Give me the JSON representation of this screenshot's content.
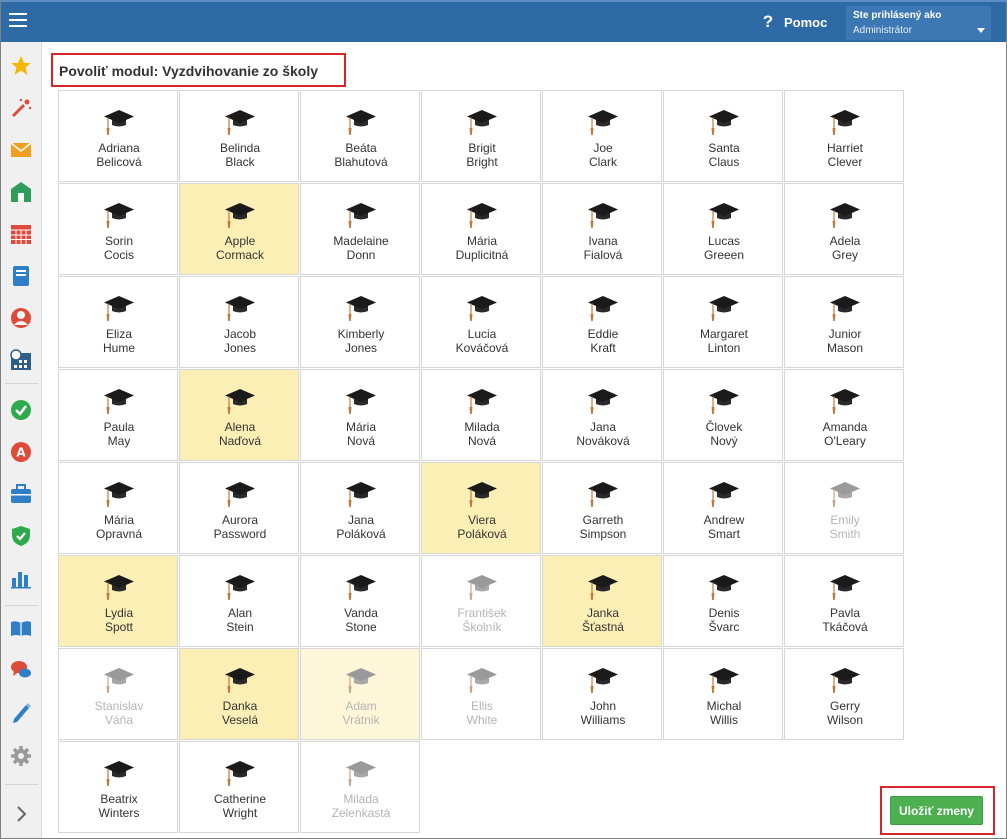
{
  "header": {
    "help_icon": "question-icon",
    "help_glyph": "?",
    "help_label": "Pomoc",
    "user_line1": "Ste prihlásený ako",
    "user_line2": "Administrátor"
  },
  "colors": {
    "header_bg": "#2e6aa6",
    "selected_card": "#fcefb5",
    "save_button": "#4caf50",
    "highlight_border": "#d9252a"
  },
  "sidebar": {
    "items": [
      {
        "icon": "star-icon",
        "color": "#f5b800"
      },
      {
        "icon": "magic-wand-icon",
        "color": "#e04a3a"
      },
      {
        "icon": "envelope-icon",
        "color": "#f0a020"
      },
      {
        "icon": "school-icon",
        "color": "#2e9e5a"
      },
      {
        "icon": "calendar-grid-icon",
        "color": "#e04a3a"
      },
      {
        "icon": "notebook-icon",
        "color": "#2e7ec8"
      },
      {
        "icon": "user-circle-icon",
        "color": "#e04a3a"
      },
      {
        "icon": "timetable-icon",
        "color": "#2e5f8a"
      },
      {
        "icon": "check-circle-icon",
        "color": "#2eaa4a"
      },
      {
        "icon": "grade-a-icon",
        "color": "#e04a3a"
      },
      {
        "icon": "briefcase-icon",
        "color": "#2e7ec8"
      },
      {
        "icon": "shield-check-icon",
        "color": "#2eaa4a"
      },
      {
        "icon": "bar-chart-icon",
        "color": "#2e7ec8"
      },
      {
        "icon": "open-book-icon",
        "color": "#2e7ec8"
      },
      {
        "icon": "chat-bubbles-icon",
        "color": "#e04a3a"
      },
      {
        "icon": "pencil-icon",
        "color": "#2e7ec8"
      },
      {
        "icon": "gear-icon",
        "color": "#9a9a9a"
      },
      {
        "icon": "chevron-right-icon",
        "color": "#666666"
      }
    ]
  },
  "page": {
    "title": "Povoliť modul: Vyzdvihovanie zo školy"
  },
  "students": [
    {
      "first": "Adriana",
      "last": "Belicová",
      "selected": false,
      "enabled": true
    },
    {
      "first": "Belinda",
      "last": "Black",
      "selected": false,
      "enabled": true
    },
    {
      "first": "Beáta",
      "last": "Blahutová",
      "selected": false,
      "enabled": true
    },
    {
      "first": "Brigit",
      "last": "Bright",
      "selected": false,
      "enabled": true
    },
    {
      "first": "Joe",
      "last": "Clark",
      "selected": false,
      "enabled": true
    },
    {
      "first": "Santa",
      "last": "Claus",
      "selected": false,
      "enabled": true
    },
    {
      "first": "Harriet",
      "last": "Clever",
      "selected": false,
      "enabled": true
    },
    {
      "first": "Sorin",
      "last": "Cocis",
      "selected": false,
      "enabled": true
    },
    {
      "first": "Apple",
      "last": "Cormack",
      "selected": true,
      "enabled": true
    },
    {
      "first": "Madelaine",
      "last": "Donn",
      "selected": false,
      "enabled": true
    },
    {
      "first": "Mária",
      "last": "Duplicitná",
      "selected": false,
      "enabled": true
    },
    {
      "first": "Ivana",
      "last": "Fialová",
      "selected": false,
      "enabled": true
    },
    {
      "first": "Lucas",
      "last": "Greeen",
      "selected": false,
      "enabled": true
    },
    {
      "first": "Adela",
      "last": "Grey",
      "selected": false,
      "enabled": true
    },
    {
      "first": "Eliza",
      "last": "Hume",
      "selected": false,
      "enabled": true
    },
    {
      "first": "Jacob",
      "last": "Jones",
      "selected": false,
      "enabled": true
    },
    {
      "first": "Kimberly",
      "last": "Jones",
      "selected": false,
      "enabled": true
    },
    {
      "first": "Lucia",
      "last": "Kováčová",
      "selected": false,
      "enabled": true
    },
    {
      "first": "Eddie",
      "last": "Kraft",
      "selected": false,
      "enabled": true
    },
    {
      "first": "Margaret",
      "last": "Linton",
      "selected": false,
      "enabled": true
    },
    {
      "first": "Junior",
      "last": "Mason",
      "selected": false,
      "enabled": true
    },
    {
      "first": "Paula",
      "last": "May",
      "selected": false,
      "enabled": true
    },
    {
      "first": "Alena",
      "last": "Naďová",
      "selected": true,
      "enabled": true
    },
    {
      "first": "Mária",
      "last": "Nová",
      "selected": false,
      "enabled": true
    },
    {
      "first": "Milada",
      "last": "Nová",
      "selected": false,
      "enabled": true
    },
    {
      "first": "Jana",
      "last": "Nováková",
      "selected": false,
      "enabled": true
    },
    {
      "first": "Človek",
      "last": "Nový",
      "selected": false,
      "enabled": true
    },
    {
      "first": "Amanda",
      "last": "O'Leary",
      "selected": false,
      "enabled": true
    },
    {
      "first": "Mária",
      "last": "Opravná",
      "selected": false,
      "enabled": true
    },
    {
      "first": "Aurora",
      "last": "Password",
      "selected": false,
      "enabled": true
    },
    {
      "first": "Jana",
      "last": "Poláková",
      "selected": false,
      "enabled": true
    },
    {
      "first": "Viera",
      "last": "Poláková",
      "selected": true,
      "enabled": true
    },
    {
      "first": "Garreth",
      "last": "Simpson",
      "selected": false,
      "enabled": true
    },
    {
      "first": "Andrew",
      "last": "Smart",
      "selected": false,
      "enabled": true
    },
    {
      "first": "Emily",
      "last": "Smith",
      "selected": false,
      "enabled": false
    },
    {
      "first": "Lydia",
      "last": "Spott",
      "selected": true,
      "enabled": true
    },
    {
      "first": "Alan",
      "last": "Stein",
      "selected": false,
      "enabled": true
    },
    {
      "first": "Vanda",
      "last": "Stone",
      "selected": false,
      "enabled": true
    },
    {
      "first": "František",
      "last": "Školník",
      "selected": false,
      "enabled": false
    },
    {
      "first": "Janka",
      "last": "Šťastná",
      "selected": true,
      "enabled": true
    },
    {
      "first": "Denis",
      "last": "Švarc",
      "selected": false,
      "enabled": true
    },
    {
      "first": "Pavla",
      "last": "Tkáčová",
      "selected": false,
      "enabled": true
    },
    {
      "first": "Stanislav",
      "last": "Váňa",
      "selected": false,
      "enabled": false
    },
    {
      "first": "Danka",
      "last": "Veselá",
      "selected": true,
      "enabled": true
    },
    {
      "first": "Adam",
      "last": "Vrátnik",
      "selected": true,
      "enabled": false
    },
    {
      "first": "Ellis",
      "last": "White",
      "selected": false,
      "enabled": false
    },
    {
      "first": "John",
      "last": "Williams",
      "selected": false,
      "enabled": true
    },
    {
      "first": "Michal",
      "last": "Willis",
      "selected": false,
      "enabled": true
    },
    {
      "first": "Gerry",
      "last": "Wilson",
      "selected": false,
      "enabled": true
    },
    {
      "first": "Beatrix",
      "last": "Winters",
      "selected": false,
      "enabled": true
    },
    {
      "first": "Catherine",
      "last": "Wright",
      "selected": false,
      "enabled": true
    },
    {
      "first": "Milada",
      "last": "Zelenkastá",
      "selected": false,
      "enabled": false
    }
  ],
  "card_icon": "graduation-cap-icon",
  "actions": {
    "save_label": "Uložiť zmeny"
  }
}
